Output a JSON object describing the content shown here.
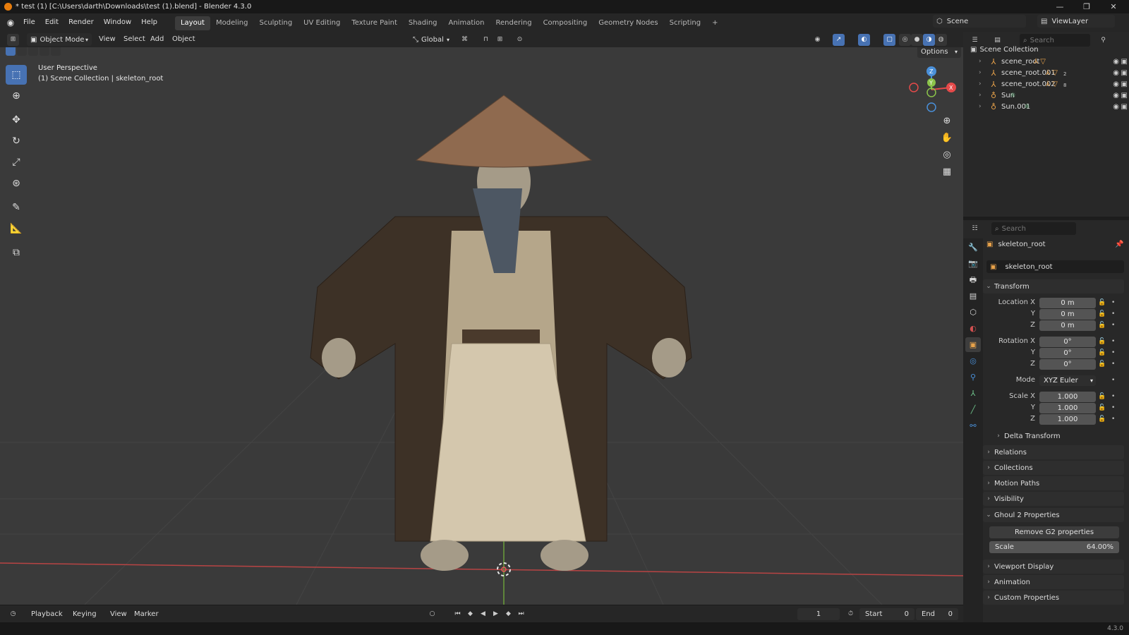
{
  "titlebar": {
    "title": "* test (1) [C:\\Users\\darth\\Downloads\\test (1).blend] - Blender 4.3.0",
    "minimize": "—",
    "maximize": "❐",
    "close": "✕"
  },
  "menubar": {
    "items": [
      "File",
      "Edit",
      "Render",
      "Window",
      "Help"
    ],
    "workspaces": [
      "Layout",
      "Modeling",
      "Sculpting",
      "UV Editing",
      "Texture Paint",
      "Shading",
      "Animation",
      "Rendering",
      "Compositing",
      "Geometry Nodes",
      "Scripting"
    ],
    "active_workspace": "Layout",
    "add_workspace": "+",
    "scene": "Scene",
    "view_layer": "ViewLayer"
  },
  "viewport_header": {
    "mode": "Object Mode",
    "menus": [
      "View",
      "Select",
      "Add",
      "Object"
    ],
    "transform_orientation": "Global",
    "options": "Options"
  },
  "viewport": {
    "perspective": "User Perspective",
    "collection_info": "(1) Scene Collection | skeleton_root",
    "gizmo": {
      "z": "Z",
      "y": "Y",
      "x": "X"
    },
    "colors": {
      "x_axis": "#e54a4a",
      "y_axis": "#8bc34a",
      "z_axis": "#4a90d9",
      "active_tool": "#4772b3"
    }
  },
  "timeline": {
    "menus": [
      "Playback",
      "Keying",
      "View",
      "Marker"
    ],
    "current_frame": "1",
    "start_label": "Start",
    "start_value": "0",
    "end_label": "End",
    "end_value": "0"
  },
  "statusbar": {
    "version": "4.3.0"
  },
  "outliner": {
    "search_placeholder": "Search",
    "root": "Scene Collection",
    "items": [
      {
        "name": "scene_root"
      },
      {
        "name": "scene_root.001",
        "count": "2"
      },
      {
        "name": "scene_root.002",
        "count": "8"
      },
      {
        "name": "Sun"
      },
      {
        "name": "Sun.001"
      }
    ]
  },
  "properties": {
    "search_placeholder": "Search",
    "object_name": "skeleton_root",
    "object_field": "skeleton_root",
    "transform": {
      "title": "Transform",
      "location_label": "Location X",
      "loc_x": "0 m",
      "loc_y": "0 m",
      "loc_z": "0 m",
      "rotation_label": "Rotation X",
      "rot_x": "0°",
      "rot_y": "0°",
      "rot_z": "0°",
      "mode_label": "Mode",
      "mode": "XYZ Euler",
      "scale_label": "Scale X",
      "scale_x": "1.000",
      "scale_y": "1.000",
      "scale_z": "1.000",
      "y_label": "Y",
      "z_label": "Z",
      "delta": "Delta Transform"
    },
    "panels": [
      "Relations",
      "Collections",
      "Motion Paths",
      "Visibility"
    ],
    "ghoul": {
      "title": "Ghoul 2 Properties",
      "remove_button": "Remove G2 properties",
      "scale_label": "Scale",
      "scale_value": "64.00%"
    },
    "panels_after": [
      "Viewport Display",
      "Animation",
      "Custom Properties"
    ]
  }
}
